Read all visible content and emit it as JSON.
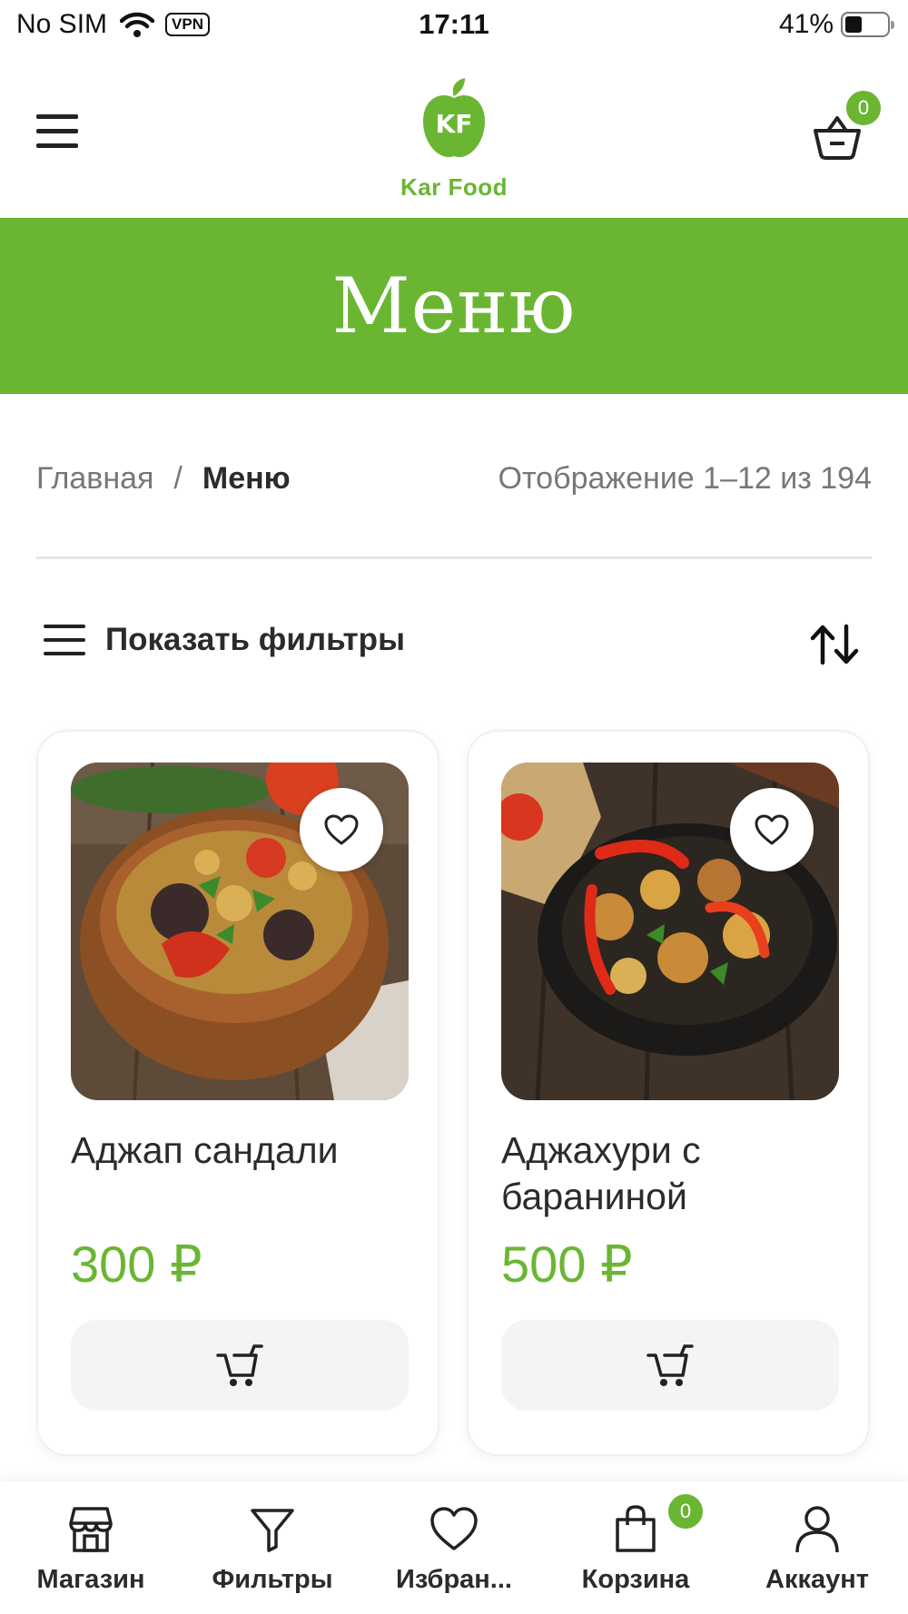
{
  "status_bar": {
    "carrier": "No SIM",
    "vpn": "VPN",
    "time": "17:11",
    "battery": "41%",
    "battery_level": 0.41
  },
  "header": {
    "logo_mark": "KF",
    "logo_text": "Kar Food",
    "cart_count": "0"
  },
  "banner": {
    "title": "Меню"
  },
  "breadcrumb": {
    "home": "Главная",
    "separator": "/",
    "current": "Меню"
  },
  "result_count": "Отображение 1–12 из 194",
  "filters": {
    "label": "Показать фильтры"
  },
  "products": [
    {
      "title": "Аджап сандали",
      "price": "300 ₽"
    },
    {
      "title": "Аджахури с бараниной",
      "price": "500 ₽"
    }
  ],
  "bottom_nav": {
    "shop": "Магазин",
    "filters": "Фильтры",
    "favorites": "Избран...",
    "cart": "Корзина",
    "cart_count": "0",
    "account": "Аккаунт"
  },
  "colors": {
    "brand_green": "#6ab633",
    "text": "#2b2b2b",
    "muted": "#777777"
  },
  "icons": [
    "menu-icon",
    "basket-icon",
    "filter-lines-icon",
    "sort-icon",
    "heart-icon",
    "cart-icon",
    "store-icon",
    "funnel-icon",
    "bag-icon",
    "user-icon"
  ]
}
